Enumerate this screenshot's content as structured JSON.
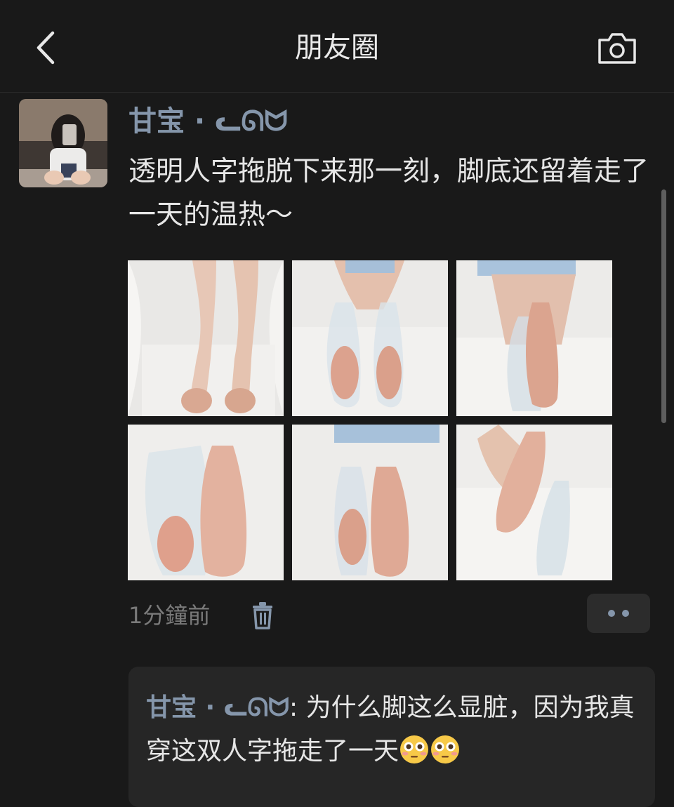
{
  "nav": {
    "title": "朋友圈",
    "back_icon": "chevron-left-icon",
    "camera_icon": "camera-icon"
  },
  "post": {
    "author": "甘宝 · ᓚᘏᗢ",
    "text": "透明人字拖脱下来那一刻，脚底还留着走了一天的温热～",
    "images": [
      {
        "name": "photo-1"
      },
      {
        "name": "photo-2"
      },
      {
        "name": "photo-3"
      },
      {
        "name": "photo-4"
      },
      {
        "name": "photo-5"
      },
      {
        "name": "photo-6"
      }
    ],
    "time": "1分鐘前",
    "delete_icon": "trash-icon",
    "more_icon": "more-dots-icon"
  },
  "comment": {
    "author": "甘宝 · ᓚᘏᗢ",
    "separator": ": ",
    "text": "为什么脚这么显脏，因为我真穿这双人字拖走了一天",
    "emoji_icon": "flushed-face-emoji"
  },
  "colors": {
    "background": "#191919",
    "name_link": "#8596ab",
    "text": "#e6e6e6",
    "muted": "#7a7a7a"
  }
}
